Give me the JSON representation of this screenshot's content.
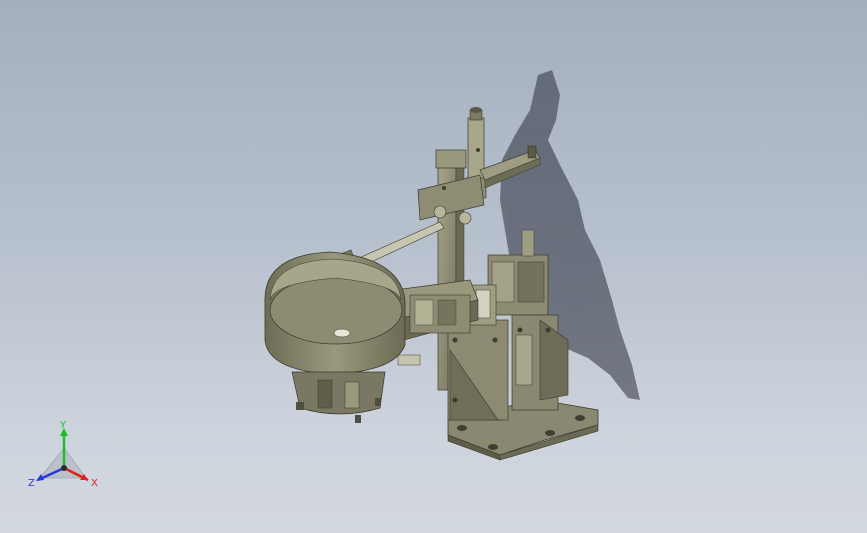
{
  "triad": {
    "x_label": "X",
    "y_label": "Y",
    "z_label": "Z",
    "x_color": "#e0201a",
    "y_color": "#18c030",
    "z_color": "#2a3ad8"
  },
  "colors": {
    "background_top": "#a4afbe",
    "background_bottom": "#d3d8e0",
    "model_body": "#8c8a70",
    "model_dark": "#5a5946",
    "model_light": "#b3b194",
    "shadow": "#2b2f3c"
  }
}
